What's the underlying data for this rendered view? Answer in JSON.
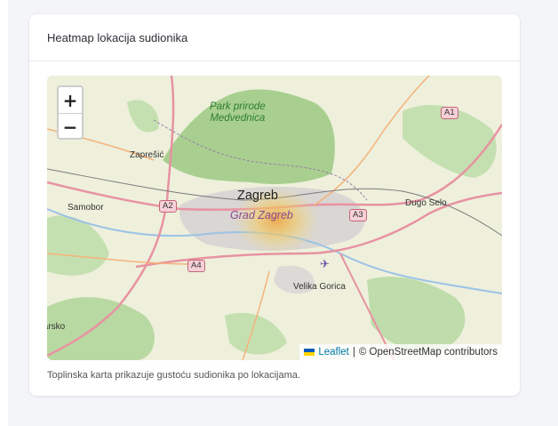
{
  "card": {
    "title": "Heatmap lokacija sudionika",
    "caption": "Toplinska karta prikazuje gustoću sudionika po lokacijama."
  },
  "map": {
    "zoom_in_label": "+",
    "zoom_out_label": "−",
    "attribution": {
      "leaflet": "Leaflet",
      "separator": "|",
      "osm": "© OpenStreetMap contributors"
    },
    "places": {
      "park_line1": "Park prirode",
      "park_line2": "Medvednica",
      "zapresic": "Zaprešić",
      "samobor": "Samobor",
      "zagreb": "Zagreb",
      "grad_zagreb": "Grad Zagreb",
      "dugo_selo": "Dugo Selo",
      "velika_gorica": "Velika Gorica",
      "jastrebarsko": "Jastrebarsko"
    },
    "roads": [
      "A4",
      "A2",
      "A3",
      "A1"
    ],
    "heat_color": "#f2b34a"
  }
}
